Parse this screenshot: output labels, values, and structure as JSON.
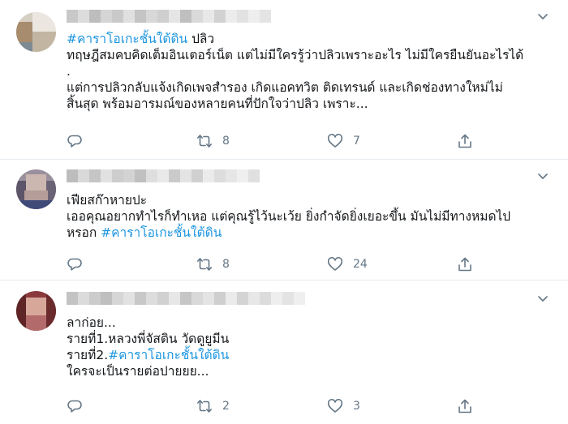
{
  "tweets": [
    {
      "hashtag": "#คาราโอเกะชั้นใต้ดิน",
      "after_hashtag": " ปลิว",
      "lines": [
        "ทฤษฎีสมคบคิดเต็มอินเตอร์เน็ต แต่ไม่มีใครรู้ว่าปลิวเพราะอะไร ไม่มีใครยืนยันอะไรได้",
        ".",
        "แต่การปลิวกลับแจ้งเกิดเพจสำรอง เกิดแอคทวิต ติดเทรนด์ และเกิดช่องทางใหม่ไม่",
        "สิ้นสุด พร้อมอารมณ์ของหลายคนที่ปักใจว่าปลิว เพราะ..."
      ],
      "retweets": "8",
      "likes": "7"
    },
    {
      "lines": [
        "เฟียสก๊าหายปะ",
        "เออคุณอยากทำไรก็ทำเหอ แต่คุณรู้ไว้นะเว้ย ยิ่งกำจัดยิ่งเยอะขึ้น มันไม่มีทางหมดไป"
      ],
      "last_prefix": "หรอก ",
      "hashtag": "#คาราโอเกะชั้นใต้ดิน",
      "retweets": "8",
      "likes": "24"
    },
    {
      "lines": [
        "ลาก่อย...",
        "รายที่1.หลวงพี่จัสติน วัดดูยูมีน"
      ],
      "prefix2": "รายที่2.",
      "hashtag": "#คาราโอเกะชั้นใต้ดิน",
      "last": "ใครจะเป็นรายต่อปายยย...",
      "retweets": "2",
      "likes": "3"
    }
  ],
  "icons": {
    "reply": "reply-icon",
    "retweet": "retweet-icon",
    "like": "like-icon",
    "share": "share-icon",
    "more": "chevron-down-icon"
  },
  "colors": {
    "hashtag": "#1b95e0",
    "icon": "#657786",
    "divider": "#e6ecf0"
  }
}
